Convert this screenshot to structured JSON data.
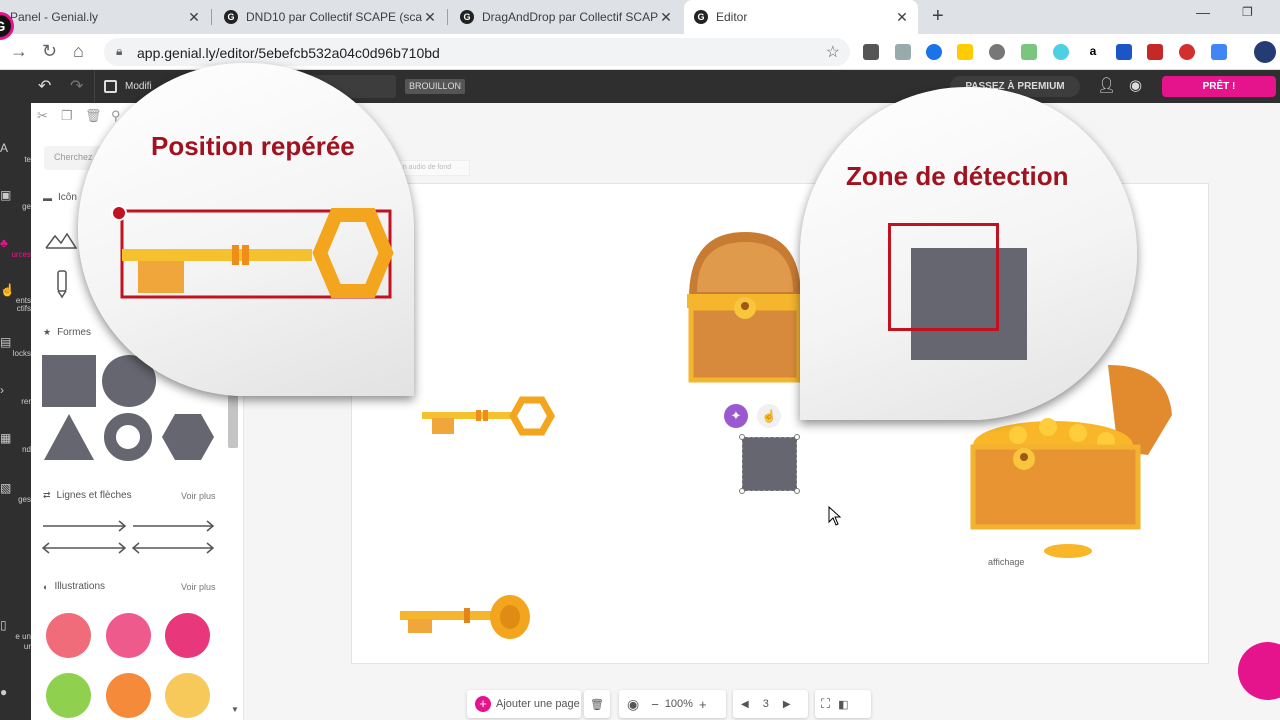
{
  "browser": {
    "tabs": [
      {
        "title": "Panel - Genial.ly"
      },
      {
        "title": "DND10 par Collectif SCAPE (scape"
      },
      {
        "title": "DragAndDrop par Collectif SCAPE"
      },
      {
        "title": "Editor"
      }
    ],
    "url": "app.genial.ly/editor/5ebefcb532a04c0d96b710bd"
  },
  "editor": {
    "modified_label": "Modifi",
    "status_badge": "BROUILLON",
    "premium_label": "PASSEZ À PREMIUM",
    "ready_label": "PRÊT !"
  },
  "rail": {
    "items": [
      {
        "label": "te",
        "icon": "text-icon"
      },
      {
        "label": "ge",
        "icon": "image-icon"
      },
      {
        "label": "urces",
        "icon": "resources-icon"
      },
      {
        "label": "ents\nctifs",
        "icon": "interactive-icon"
      },
      {
        "label": "locks",
        "icon": "blocks-icon"
      },
      {
        "label": "rer",
        "icon": "insert-icon"
      },
      {
        "label": "nd",
        "icon": "background-icon"
      },
      {
        "label": "ges",
        "icon": "pages-icon"
      },
      {
        "label": "e un\nur",
        "icon": "collab-icon"
      }
    ]
  },
  "panel": {
    "search_placeholder": "Cherchez",
    "icons_label": "Icôn",
    "shapes_label": "Formes",
    "lines_label": "Lignes et flèches",
    "lines_more": "Voir plus",
    "illustrations_label": "Illustrations",
    "illustrations_more": "Voir plus"
  },
  "canvas": {
    "audio_hint": "...n audio de fond",
    "caption": "affichage"
  },
  "bubbles": {
    "left_title": "Position repérée",
    "right_title": "Zone de détection"
  },
  "bottombar": {
    "add_page": "Ajouter une page",
    "zoom": "100%",
    "page_number": "3"
  },
  "colors": {
    "accent": "#e6148c",
    "dark_bar": "#2f2f2f",
    "title_red": "#a0121f",
    "shape_gray": "#666670",
    "key_gold": "#f5b52c"
  }
}
